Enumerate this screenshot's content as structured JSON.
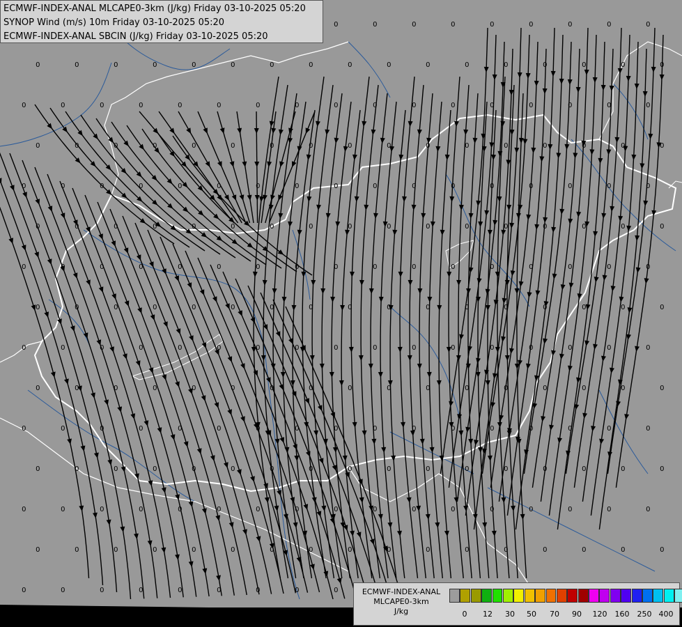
{
  "header": {
    "line1": "ECMWF-INDEX-ANAL MLCAPE0-3km (J/kg) Friday 03-10-2025 05:20",
    "line2": "SYNOP Wind (m/s) 10m Friday 03-10-2025 05:20",
    "line3": "ECMWF-INDEX-ANAL SBCIN (J/kg) Friday 03-10-2025 05:20"
  },
  "legend": {
    "title1": "ECMWF-INDEX-ANAL",
    "title2": "MLCAPE0-3km",
    "unit": "J/kg",
    "colors": [
      "#9c9c9c",
      "#b0a000",
      "#9a9a00",
      "#10b010",
      "#20e000",
      "#a0f000",
      "#f0f000",
      "#f0c000",
      "#f0a000",
      "#f07000",
      "#e04000",
      "#c00000",
      "#a00000",
      "#f000f0",
      "#c000f0",
      "#8000f0",
      "#5000f0",
      "#2020f0",
      "#0070f0",
      "#00c0f0",
      "#00f0f0",
      "#80f0f0",
      "#ffffff"
    ],
    "tick_labels": [
      "0",
      "12",
      "30",
      "50",
      "70",
      "90",
      "120",
      "160",
      "250",
      "400"
    ]
  },
  "map": {
    "background": "#999999",
    "border_color": "#ffffff",
    "river_color": "#2a5a9a",
    "streamline_color": "#000000",
    "value_label": "0"
  }
}
